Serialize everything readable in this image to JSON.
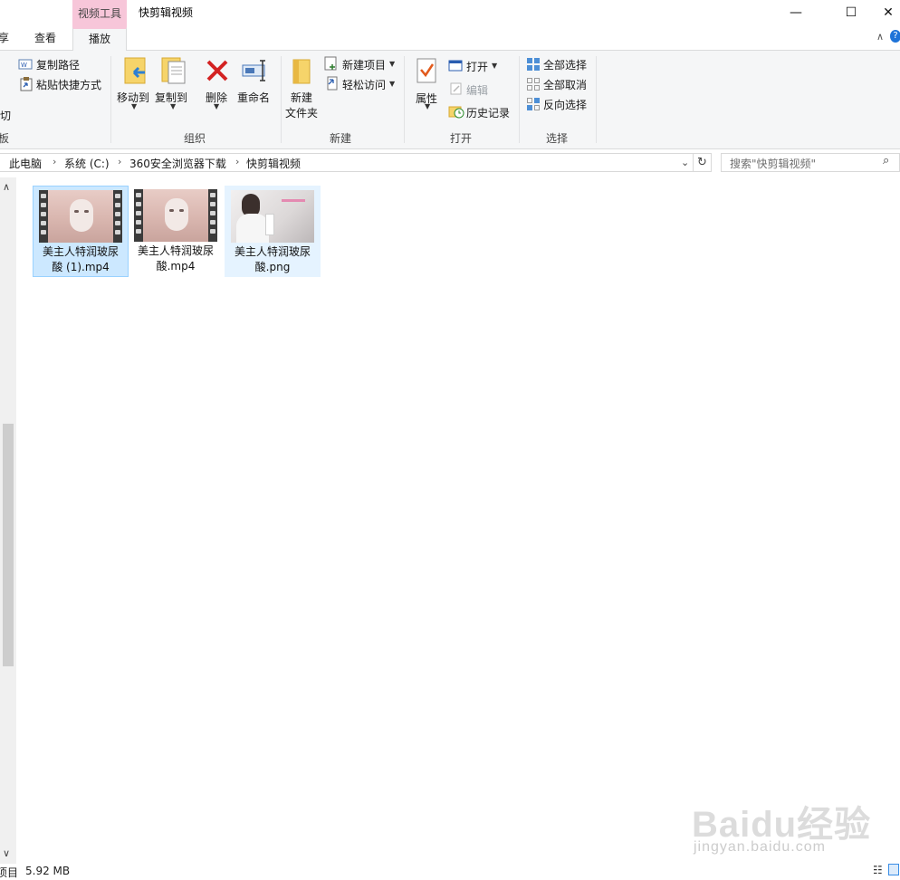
{
  "titlebar": {
    "context_tab": "视频工具",
    "window_title": "快剪辑视频",
    "minimize": "—",
    "maximize": "☐",
    "close": "✕"
  },
  "tabs": {
    "share": "享",
    "view": "查看",
    "play": "播放"
  },
  "ribbon": {
    "clipboard": {
      "copy_path": "复制路径",
      "paste_shortcut": "粘贴快捷方式",
      "cut": "剪切",
      "group": "板"
    },
    "organize": {
      "move_to": "移动到",
      "copy_to": "复制到",
      "delete": "删除",
      "rename": "重命名",
      "group": "组织"
    },
    "new": {
      "new_folder_line1": "新建",
      "new_folder_line2": "文件夹",
      "new_item": "新建项目",
      "easy_access": "轻松访问",
      "group": "新建"
    },
    "open": {
      "properties": "属性",
      "open": "打开",
      "edit": "编辑",
      "history": "历史记录",
      "group": "打开"
    },
    "select": {
      "select_all": "全部选择",
      "select_none": "全部取消",
      "invert": "反向选择",
      "group": "选择"
    }
  },
  "address": {
    "crumbs": [
      "此电脑",
      "系统 (C:)",
      "360安全浏览器下载",
      "快剪辑视频"
    ],
    "search_placeholder": "搜索\"快剪辑视频\""
  },
  "files": [
    {
      "line1": "美主人特润玻尿",
      "line2": "酸 (1).mp4",
      "kind": "video"
    },
    {
      "line1": "美主人特润玻尿",
      "line2": "酸.mp4",
      "kind": "video"
    },
    {
      "line1": "美主人特润玻尿",
      "line2": "酸.png",
      "kind": "image"
    }
  ],
  "status": {
    "items": "项目",
    "size": "5.92 MB"
  },
  "watermark": {
    "brand": "Baidu经验",
    "url": "jingyan.baidu.com"
  },
  "colors": {
    "context_tab_bg": "#f7c6d9",
    "selected_bg": "#cce8ff",
    "hover_bg": "#e5f3ff"
  }
}
